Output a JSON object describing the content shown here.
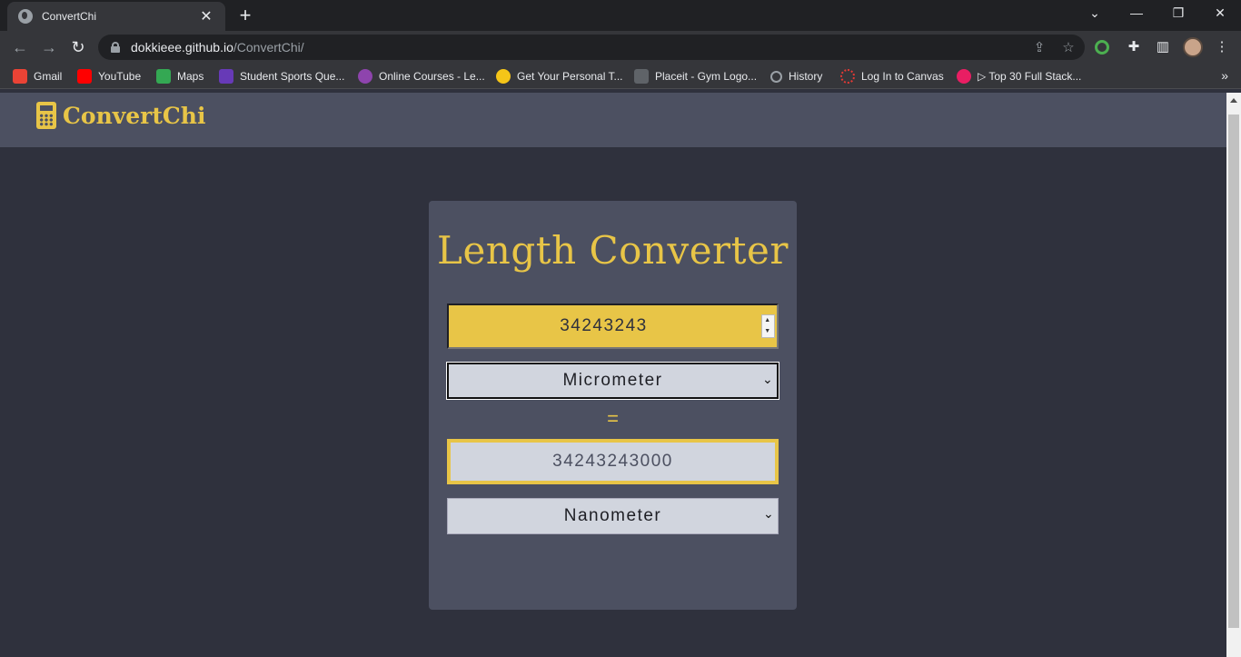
{
  "browser": {
    "tab_title": "ConvertChi",
    "url_host": "dokkieee.github.io",
    "url_path": "/ConvertChi/",
    "bookmarks": [
      {
        "label": "Gmail",
        "color": "#ea4335"
      },
      {
        "label": "YouTube",
        "color": "#ff0000"
      },
      {
        "label": "Maps",
        "color": "#34a853"
      },
      {
        "label": "Student Sports Que...",
        "color": "#673ab7"
      },
      {
        "label": "Online Courses - Le...",
        "color": "#8e44ad"
      },
      {
        "label": "Get Your Personal T...",
        "color": "#f5c518"
      },
      {
        "label": "Placeit - Gym Logo...",
        "color": "#5f6368"
      },
      {
        "label": "History",
        "color": "#9aa0a6"
      },
      {
        "label": "Log In to Canvas",
        "color": "#e53935"
      },
      {
        "label": "▷ Top 30 Full Stack...",
        "color": "#e91e63"
      }
    ]
  },
  "app": {
    "brand": "ConvertChi",
    "title": "Length Converter",
    "input_value": "34243243",
    "from_unit": "Micrometer",
    "equals": "=",
    "result_value": "34243243000",
    "to_unit": "Nanometer"
  },
  "colors": {
    "accent": "#e8c547",
    "navbar": "#4c5061",
    "background": "#2f313d"
  }
}
